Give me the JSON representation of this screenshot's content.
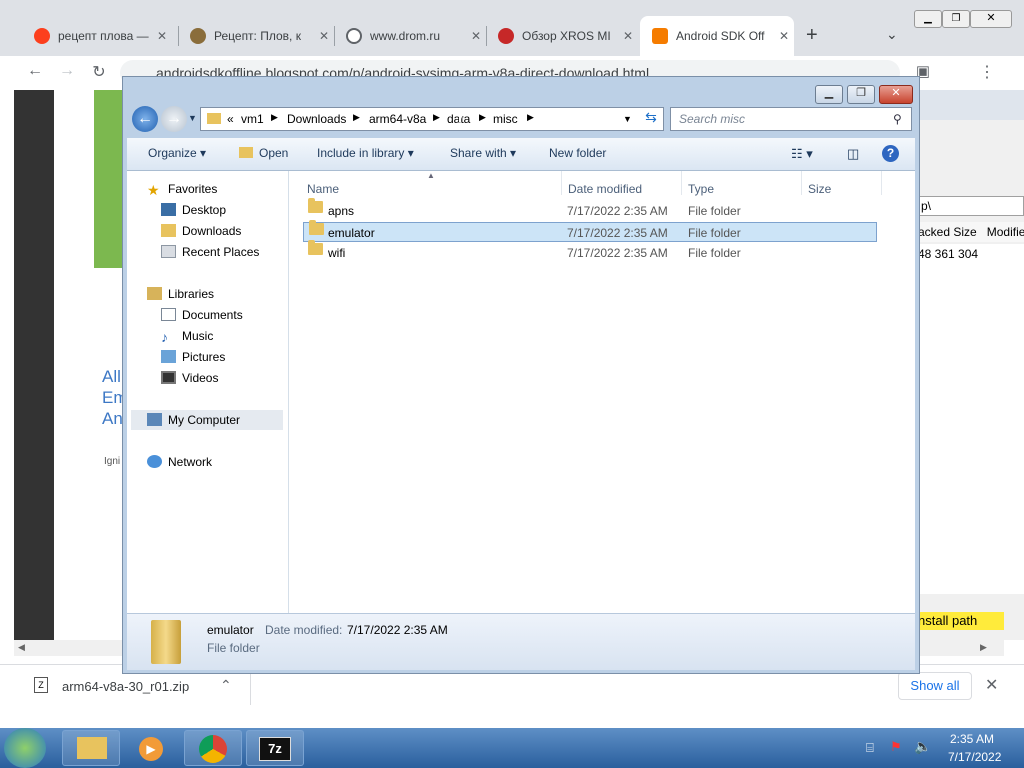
{
  "browser": {
    "tabs": [
      {
        "title": "рецепт плова — ",
        "icon_color": "#fc3f1d",
        "icon": "yandex-icon"
      },
      {
        "title": "Рецепт: Плов, к",
        "icon_color": "#8a6d3b",
        "icon": "recipe-icon"
      },
      {
        "title": "www.drom.ru",
        "icon_color": "#5f6368",
        "icon": "globe-icon"
      },
      {
        "title": "Обзор XROS MI",
        "icon_color": "#c62828",
        "icon": "vape-site-icon"
      },
      {
        "title": "Android SDK Off",
        "icon_color": "#f57c00",
        "icon": "blogger-icon"
      }
    ],
    "address": "androidsdkoffline.blogspot.com/p/android-sysimg-arm-v8a-direct-download.html",
    "page_side_text": [
      "All",
      "Em",
      "An"
    ],
    "page_small_text": "Igni",
    "right_panel": {
      "path": "p\\",
      "col1": "acked Size",
      "col2": "Modifie",
      "value": "48 361 304",
      "install": "nstall path"
    },
    "download": {
      "filename": "arm64-v8a-30_r01.zip",
      "show_all": "Show all"
    }
  },
  "explorer": {
    "breadcrumb": [
      "«",
      "vm1",
      "Downloads",
      "arm64-v8a",
      "data",
      "misc"
    ],
    "search_placeholder": "Search misc",
    "commands": {
      "organize": "Organize",
      "open": "Open",
      "include": "Include in library",
      "share": "Share with",
      "new_folder": "New folder"
    },
    "nav": {
      "favorites": "Favorites",
      "favorites_items": [
        "Desktop",
        "Downloads",
        "Recent Places"
      ],
      "libraries": "Libraries",
      "libraries_items": [
        "Documents",
        "Music",
        "Pictures",
        "Videos"
      ],
      "computer": "My Computer",
      "network": "Network"
    },
    "columns": {
      "name": "Name",
      "date": "Date modified",
      "type": "Type",
      "size": "Size"
    },
    "files": [
      {
        "name": "apns",
        "date": "7/17/2022 2:35 AM",
        "type": "File folder",
        "selected": false
      },
      {
        "name": "emulator",
        "date": "7/17/2022 2:35 AM",
        "type": "File folder",
        "selected": true
      },
      {
        "name": "wifi",
        "date": "7/17/2022 2:35 AM",
        "type": "File folder",
        "selected": false
      }
    ],
    "details": {
      "name": "emulator",
      "date_label": "Date modified:",
      "date": "7/17/2022 2:35 AM",
      "type": "File folder"
    }
  },
  "taskbar": {
    "time": "2:35 AM",
    "date": "7/17/2022"
  }
}
